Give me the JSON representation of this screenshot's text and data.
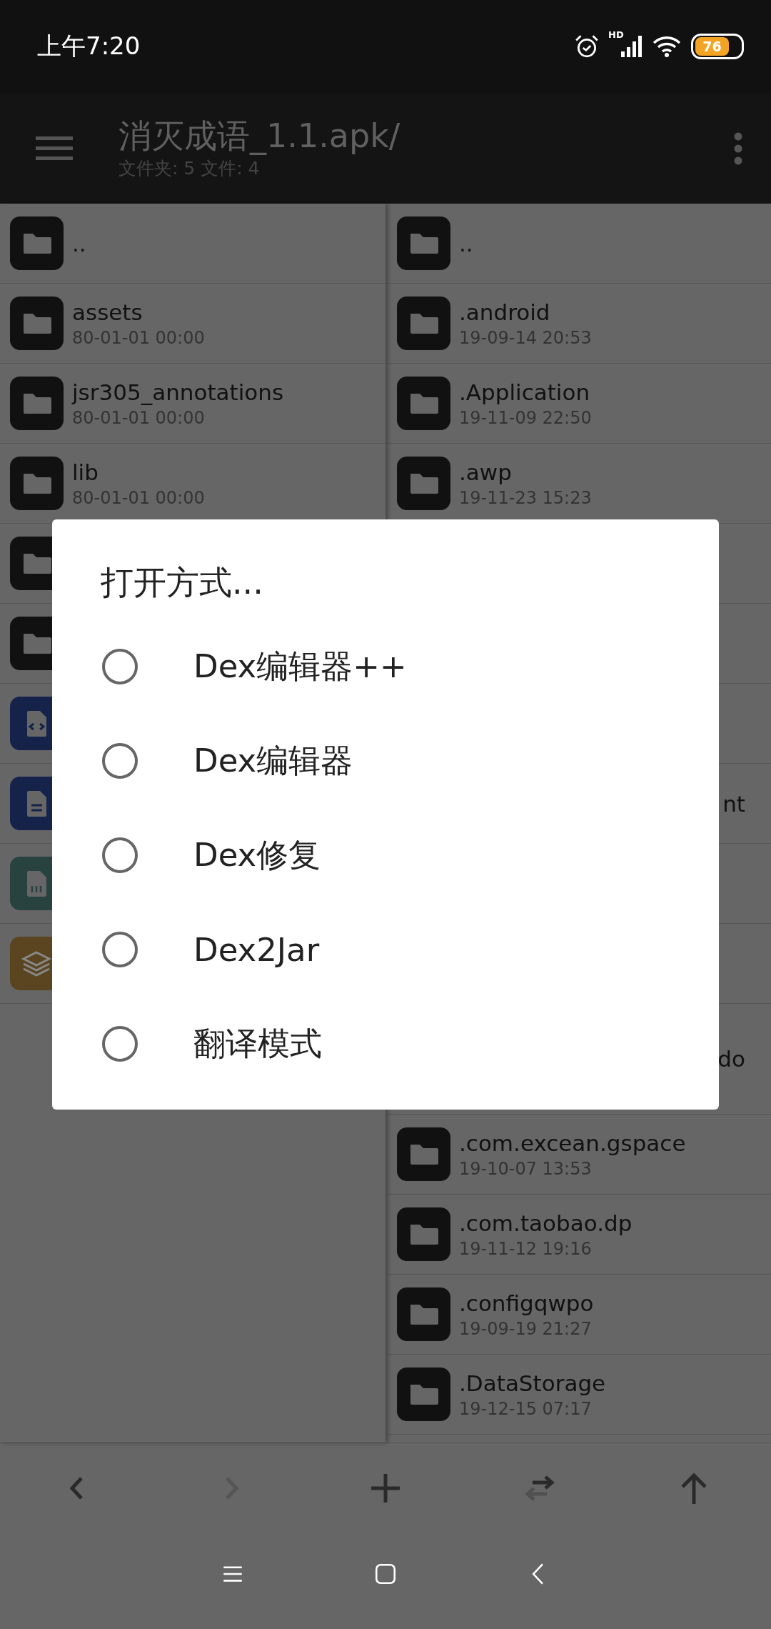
{
  "status_bar": {
    "time": "上午7:20",
    "hd_label": "HD",
    "battery": "76"
  },
  "app_bar": {
    "title": "消灭成语_1.1.apk/",
    "subtitle": "文件夹: 5  文件: 4"
  },
  "left_pane": {
    "rows": [
      {
        "kind": "folder",
        "name": ".."
      },
      {
        "kind": "folder",
        "name": "assets",
        "date": "80-01-01 00:00"
      },
      {
        "kind": "folder",
        "name": "jsr305_annotations",
        "date": "80-01-01 00:00"
      },
      {
        "kind": "folder",
        "name": "lib",
        "date": "80-01-01 00:00"
      },
      {
        "kind": "folder"
      },
      {
        "kind": "folder"
      },
      {
        "kind": "code"
      },
      {
        "kind": "text"
      },
      {
        "kind": "binary"
      },
      {
        "kind": "layers"
      }
    ]
  },
  "right_pane": {
    "rows": [
      {
        "kind": "folder",
        "name": ".."
      },
      {
        "kind": "folder",
        "name": ".android",
        "date": "19-09-14 20:53"
      },
      {
        "kind": "folder",
        "name": ".Application",
        "date": "19-11-09 22:50"
      },
      {
        "kind": "folder",
        "name": ".awp",
        "date": "19-11-23 15:23"
      },
      {
        "kind": "hidden"
      },
      {
        "kind": "hidden"
      },
      {
        "kind": "hidden"
      },
      {
        "kind": "clipped",
        "name": "nt"
      },
      {
        "kind": "hidden"
      },
      {
        "kind": "hidden"
      },
      {
        "kind": "clipped",
        "name": "do",
        "wrapped": true
      },
      {
        "kind": "folder",
        "name": ".com.excean.gspace",
        "date": "19-10-07 13:53"
      },
      {
        "kind": "folder",
        "name": ".com.taobao.dp",
        "date": "19-11-12 19:16"
      },
      {
        "kind": "folder",
        "name": ".configqwpo",
        "date": "19-09-19 21:27"
      },
      {
        "kind": "folder",
        "name": ".DataStorage",
        "date": "19-12-15 07:17"
      }
    ]
  },
  "toolbar": [
    {
      "kind": "back",
      "disabled": false
    },
    {
      "kind": "forward",
      "disabled": true
    },
    {
      "kind": "add",
      "disabled": false
    },
    {
      "kind": "swap",
      "disabled": false
    },
    {
      "kind": "up",
      "disabled": false
    }
  ],
  "dialog": {
    "title": "打开方式...",
    "options": [
      {
        "label": "Dex编辑器++",
        "selected": false
      },
      {
        "label": "Dex编辑器",
        "selected": false
      },
      {
        "label": "Dex修复",
        "selected": false
      },
      {
        "label": "Dex2Jar",
        "selected": false
      },
      {
        "label": "翻译模式",
        "selected": false
      }
    ]
  },
  "nav_bar": [
    {
      "kind": "menu"
    },
    {
      "kind": "home"
    },
    {
      "kind": "back"
    }
  ]
}
